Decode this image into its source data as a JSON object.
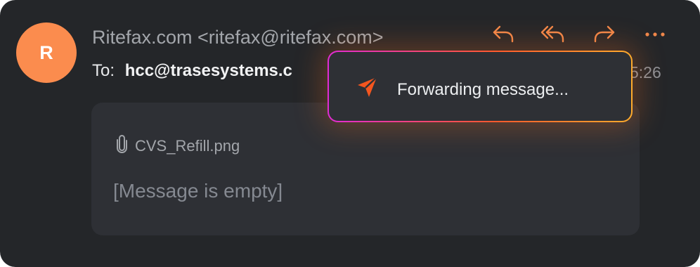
{
  "email": {
    "avatar_initial": "R",
    "sender": "Ritefax.com <ritefax@ritefax.com>",
    "to_label": "To:",
    "to_address": "hcc@trasesystems.c",
    "time_partial": "5:26",
    "attachment_name": "CVS_Refill.png",
    "empty_message": "[Message is empty]"
  },
  "toast": {
    "text": "Forwarding message..."
  },
  "icons": {
    "reply": "reply-icon",
    "reply_all": "reply-all-icon",
    "forward": "forward-icon",
    "more": "more-icon",
    "attachment": "paperclip-icon",
    "send": "send-icon"
  },
  "colors": {
    "background": "#242629",
    "panel": "#2e3035",
    "accent": "#fb8c4e",
    "toast_gradient_start": "#e12bd4",
    "toast_gradient_end": "#ffab2c"
  }
}
